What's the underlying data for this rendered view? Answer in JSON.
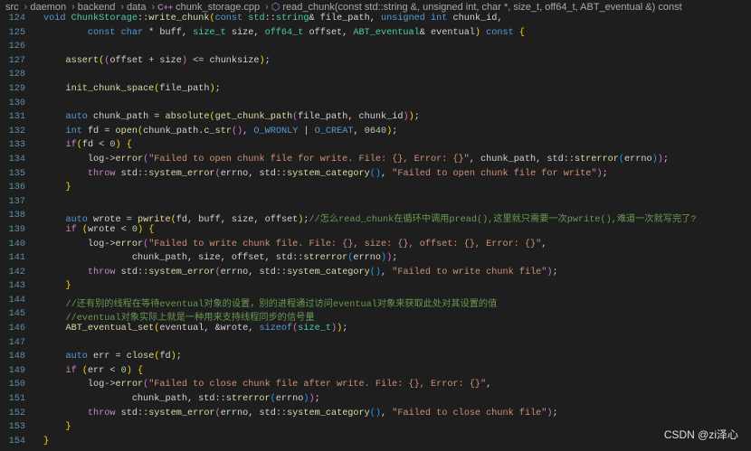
{
  "breadcrumb": {
    "items": [
      "src",
      "daemon",
      "backend",
      "data",
      "chunk_storage.cpp",
      "read_chunk(const std::string &, unsigned int, char *, size_t, off64_t, ABT_eventual &) const"
    ],
    "file_icon": "C++",
    "symbol_icon": "cube-icon"
  },
  "watermark": "CSDN @zi泽心",
  "lines": [
    {
      "n": "124",
      "t": [
        [
          "k",
          "void "
        ],
        [
          "t",
          "ChunkStorage"
        ],
        [
          "p",
          "::"
        ],
        [
          "f",
          "write_chunk"
        ],
        [
          "b1",
          "("
        ],
        [
          "k",
          "const "
        ],
        [
          "t",
          "std"
        ],
        [
          "p",
          "::"
        ],
        [
          "t",
          "string"
        ],
        [
          "p",
          "& file_path, "
        ],
        [
          "k",
          "unsigned int "
        ],
        [
          "p",
          "chunk_id,"
        ]
      ]
    },
    {
      "n": "125",
      "t": [
        [
          "p",
          "        "
        ],
        [
          "k",
          "const char "
        ],
        [
          "p",
          "* buff, "
        ],
        [
          "t",
          "size_t"
        ],
        [
          "p",
          " size, "
        ],
        [
          "t",
          "off64_t"
        ],
        [
          "p",
          " offset, "
        ],
        [
          "t",
          "ABT_eventual"
        ],
        [
          "p",
          "& eventual"
        ],
        [
          "b1",
          ")"
        ],
        [
          "k",
          " const "
        ],
        [
          "b1",
          "{"
        ]
      ]
    },
    {
      "n": "126",
      "t": []
    },
    {
      "n": "127",
      "t": [
        [
          "p",
          "    "
        ],
        [
          "f",
          "assert"
        ],
        [
          "b1",
          "("
        ],
        [
          "b2",
          "("
        ],
        [
          "p",
          "offset + size"
        ],
        [
          "b2",
          ")"
        ],
        [
          "p",
          " <= chunksize"
        ],
        [
          "b1",
          ")"
        ],
        [
          "p",
          ";"
        ]
      ]
    },
    {
      "n": "128",
      "t": []
    },
    {
      "n": "129",
      "t": [
        [
          "p",
          "    "
        ],
        [
          "f",
          "init_chunk_space"
        ],
        [
          "b1",
          "("
        ],
        [
          "p",
          "file_path"
        ],
        [
          "b1",
          ")"
        ],
        [
          "p",
          ";"
        ]
      ]
    },
    {
      "n": "130",
      "t": []
    },
    {
      "n": "131",
      "t": [
        [
          "p",
          "    "
        ],
        [
          "k",
          "auto "
        ],
        [
          "p",
          "chunk_path = "
        ],
        [
          "f",
          "absolute"
        ],
        [
          "b1",
          "("
        ],
        [
          "f",
          "get_chunk_path"
        ],
        [
          "b2",
          "("
        ],
        [
          "p",
          "file_path, chunk_id"
        ],
        [
          "b2",
          ")"
        ],
        [
          "b1",
          ")"
        ],
        [
          "p",
          ";"
        ]
      ]
    },
    {
      "n": "132",
      "t": [
        [
          "p",
          "    "
        ],
        [
          "k",
          "int "
        ],
        [
          "p",
          "fd = "
        ],
        [
          "f",
          "open"
        ],
        [
          "b1",
          "("
        ],
        [
          "p",
          "chunk_path."
        ],
        [
          "f",
          "c_str"
        ],
        [
          "b2",
          "()"
        ],
        [
          "p",
          ", "
        ],
        [
          "mac",
          "O_WRONLY"
        ],
        [
          "p",
          " | "
        ],
        [
          "mac",
          "O_CREAT"
        ],
        [
          "p",
          ", "
        ],
        [
          "n",
          "0640"
        ],
        [
          "b1",
          ")"
        ],
        [
          "p",
          ";"
        ]
      ]
    },
    {
      "n": "133",
      "t": [
        [
          "p",
          "    "
        ],
        [
          "c",
          "if"
        ],
        [
          "b1",
          "("
        ],
        [
          "p",
          "fd < "
        ],
        [
          "n",
          "0"
        ],
        [
          "b1",
          ")"
        ],
        [
          "p",
          " "
        ],
        [
          "b1",
          "{"
        ]
      ]
    },
    {
      "n": "134",
      "t": [
        [
          "p",
          "        log->"
        ],
        [
          "f",
          "error"
        ],
        [
          "b2",
          "("
        ],
        [
          "s",
          "\"Failed to open chunk file for write. File: {}, Error: {}\""
        ],
        [
          "p",
          ", chunk_path, std::"
        ],
        [
          "f",
          "strerror"
        ],
        [
          "b3",
          "("
        ],
        [
          "p",
          "errno"
        ],
        [
          "b3",
          ")"
        ],
        [
          "b2",
          ")"
        ],
        [
          "p",
          ";"
        ]
      ]
    },
    {
      "n": "135",
      "t": [
        [
          "p",
          "        "
        ],
        [
          "c",
          "throw "
        ],
        [
          "p",
          "std::"
        ],
        [
          "f",
          "system_error"
        ],
        [
          "b2",
          "("
        ],
        [
          "p",
          "errno, std::"
        ],
        [
          "f",
          "system_category"
        ],
        [
          "b3",
          "()"
        ],
        [
          "p",
          ", "
        ],
        [
          "s",
          "\"Failed to open chunk file for write\""
        ],
        [
          "b2",
          ")"
        ],
        [
          "p",
          ";"
        ]
      ]
    },
    {
      "n": "136",
      "t": [
        [
          "p",
          "    "
        ],
        [
          "b1",
          "}"
        ]
      ]
    },
    {
      "n": "137",
      "t": []
    },
    {
      "n": "138",
      "t": [
        [
          "p",
          "    "
        ],
        [
          "k",
          "auto "
        ],
        [
          "p",
          "wrote = "
        ],
        [
          "f",
          "pwrite"
        ],
        [
          "b1",
          "("
        ],
        [
          "p",
          "fd, buff, size, offset"
        ],
        [
          "b1",
          ")"
        ],
        [
          "p",
          ";"
        ],
        [
          "m",
          "//怎么read_chunk在循环中调用pread(),这里就只需要一次pwrite(),难道一次就写完了?"
        ]
      ]
    },
    {
      "n": "139",
      "t": [
        [
          "p",
          "    "
        ],
        [
          "c",
          "if "
        ],
        [
          "b1",
          "("
        ],
        [
          "p",
          "wrote < "
        ],
        [
          "n",
          "0"
        ],
        [
          "b1",
          ")"
        ],
        [
          "p",
          " "
        ],
        [
          "b1",
          "{"
        ]
      ]
    },
    {
      "n": "140",
      "t": [
        [
          "p",
          "        log->"
        ],
        [
          "f",
          "error"
        ],
        [
          "b2",
          "("
        ],
        [
          "s",
          "\"Failed to write chunk file. File: {}, size: {}, offset: {}, Error: {}\""
        ],
        [
          "p",
          ","
        ]
      ]
    },
    {
      "n": "141",
      "t": [
        [
          "p",
          "                chunk_path, size, offset, std::"
        ],
        [
          "f",
          "strerror"
        ],
        [
          "b3",
          "("
        ],
        [
          "p",
          "errno"
        ],
        [
          "b3",
          ")"
        ],
        [
          "b2",
          ")"
        ],
        [
          "p",
          ";"
        ]
      ]
    },
    {
      "n": "142",
      "t": [
        [
          "p",
          "        "
        ],
        [
          "c",
          "throw "
        ],
        [
          "p",
          "std::"
        ],
        [
          "f",
          "system_error"
        ],
        [
          "b2",
          "("
        ],
        [
          "p",
          "errno, std::"
        ],
        [
          "f",
          "system_category"
        ],
        [
          "b3",
          "()"
        ],
        [
          "p",
          ", "
        ],
        [
          "s",
          "\"Failed to write chunk file\""
        ],
        [
          "b2",
          ")"
        ],
        [
          "p",
          ";"
        ]
      ]
    },
    {
      "n": "143",
      "t": [
        [
          "p",
          "    "
        ],
        [
          "b1",
          "}"
        ]
      ]
    },
    {
      "n": "144",
      "t": [
        [
          "p",
          "    "
        ],
        [
          "m",
          "//还有别的线程在等待eventual对象的设置，别的进程通过访问eventual对象来获取此处对其设置的值"
        ]
      ]
    },
    {
      "n": "145",
      "t": [
        [
          "p",
          "    "
        ],
        [
          "m",
          "//eventual对象实际上就是一种用来支持线程同步的信号量"
        ]
      ]
    },
    {
      "n": "146",
      "t": [
        [
          "p",
          "    "
        ],
        [
          "f",
          "ABT_eventual_set"
        ],
        [
          "b1",
          "("
        ],
        [
          "p",
          "eventual, &wrote, "
        ],
        [
          "k",
          "sizeof"
        ],
        [
          "b2",
          "("
        ],
        [
          "t",
          "size_t"
        ],
        [
          "b2",
          ")"
        ],
        [
          "b1",
          ")"
        ],
        [
          "p",
          ";"
        ]
      ]
    },
    {
      "n": "147",
      "t": []
    },
    {
      "n": "148",
      "t": [
        [
          "p",
          "    "
        ],
        [
          "k",
          "auto "
        ],
        [
          "p",
          "err = "
        ],
        [
          "f",
          "close"
        ],
        [
          "b1",
          "("
        ],
        [
          "p",
          "fd"
        ],
        [
          "b1",
          ")"
        ],
        [
          "p",
          ";"
        ]
      ]
    },
    {
      "n": "149",
      "t": [
        [
          "p",
          "    "
        ],
        [
          "c",
          "if "
        ],
        [
          "b1",
          "("
        ],
        [
          "p",
          "err < "
        ],
        [
          "n",
          "0"
        ],
        [
          "b1",
          ")"
        ],
        [
          "p",
          " "
        ],
        [
          "b1",
          "{"
        ]
      ]
    },
    {
      "n": "150",
      "t": [
        [
          "p",
          "        log->"
        ],
        [
          "f",
          "error"
        ],
        [
          "b2",
          "("
        ],
        [
          "s",
          "\"Failed to close chunk file after write. File: {}, Error: {}\""
        ],
        [
          "p",
          ","
        ]
      ]
    },
    {
      "n": "151",
      "t": [
        [
          "p",
          "                chunk_path, std::"
        ],
        [
          "f",
          "strerror"
        ],
        [
          "b3",
          "("
        ],
        [
          "p",
          "errno"
        ],
        [
          "b3",
          ")"
        ],
        [
          "b2",
          ")"
        ],
        [
          "p",
          ";"
        ]
      ]
    },
    {
      "n": "152",
      "t": [
        [
          "p",
          "        "
        ],
        [
          "c",
          "throw "
        ],
        [
          "p",
          "std::"
        ],
        [
          "f",
          "system_error"
        ],
        [
          "b2",
          "("
        ],
        [
          "p",
          "errno, std::"
        ],
        [
          "f",
          "system_category"
        ],
        [
          "b3",
          "()"
        ],
        [
          "p",
          ", "
        ],
        [
          "s",
          "\"Failed to close chunk file\""
        ],
        [
          "b2",
          ")"
        ],
        [
          "p",
          ";"
        ]
      ]
    },
    {
      "n": "153",
      "t": [
        [
          "p",
          "    "
        ],
        [
          "b1",
          "}"
        ]
      ]
    },
    {
      "n": "154",
      "t": [
        [
          "b1",
          "}"
        ]
      ]
    }
  ]
}
